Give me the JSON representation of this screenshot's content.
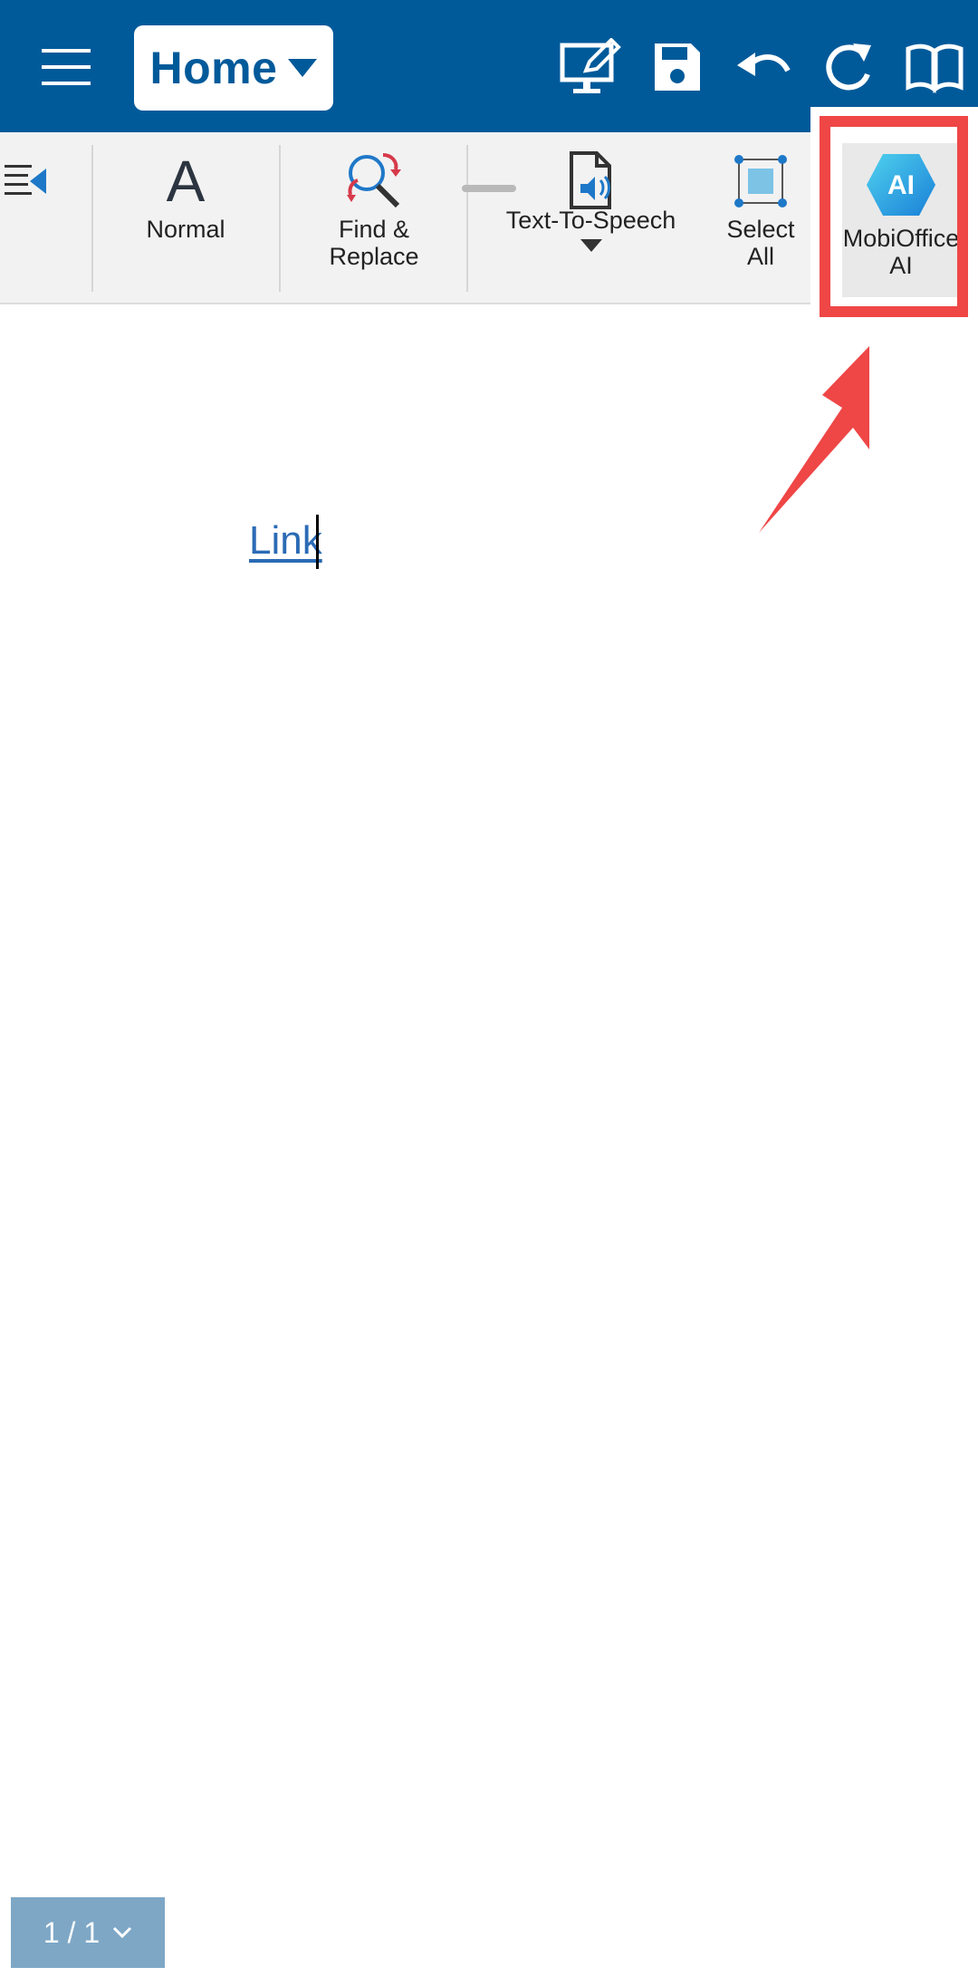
{
  "colors": {
    "topbar": "#005a9a",
    "ribbon": "#f2f2f2",
    "highlight": "#ef4646",
    "link": "#2b6bb5",
    "page_indicator": "#7ea7c6"
  },
  "topbar": {
    "mode": "Home",
    "icons": [
      "menu-icon",
      "present-edit-icon",
      "save-icon",
      "undo-icon",
      "redo-icon",
      "reading-mode-icon"
    ]
  },
  "ribbon": {
    "items": [
      {
        "label": "Normal",
        "icon": "text-style-icon",
        "glyph": "A"
      },
      {
        "label": "Find &\nReplace",
        "icon": "find-replace-icon"
      },
      {
        "label": "Text-To-Speech",
        "icon": "text-to-speech-icon"
      },
      {
        "label": "Select\nAll",
        "icon": "select-all-icon"
      },
      {
        "label": "MobiOffice\nAI",
        "icon": "ai-icon",
        "badge": "AI"
      }
    ]
  },
  "document": {
    "link_text": "Link"
  },
  "footer": {
    "page_indicator": "1 / 1"
  }
}
